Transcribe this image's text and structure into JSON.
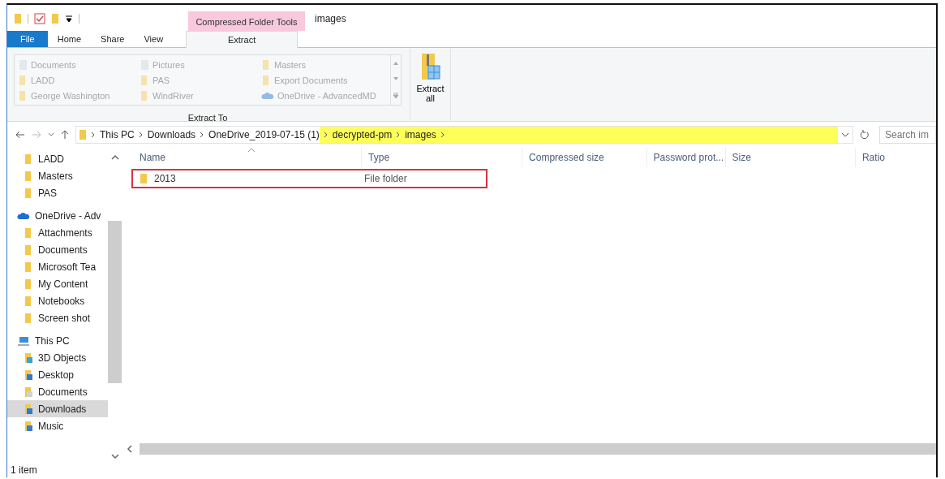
{
  "title_bar": {
    "context_tab_group": "Compressed Folder Tools",
    "title": "images"
  },
  "ribbon_tabs": [
    {
      "label": "File",
      "kind": "file",
      "selected": false
    },
    {
      "label": "Home",
      "kind": "tab",
      "selected": false
    },
    {
      "label": "Share",
      "kind": "tab",
      "selected": false
    },
    {
      "label": "View",
      "kind": "tab",
      "selected": false
    },
    {
      "label": "Extract",
      "kind": "context",
      "selected": true
    }
  ],
  "extract_to": {
    "group_label": "Extract To",
    "locations": [
      {
        "label": "Documents",
        "kind": "library",
        "disabled": true
      },
      {
        "label": "Pictures",
        "kind": "library",
        "disabled": true
      },
      {
        "label": "Masters",
        "kind": "folder",
        "disabled": true
      },
      {
        "label": "LADD",
        "kind": "folder",
        "disabled": true
      },
      {
        "label": "PAS",
        "kind": "folder",
        "disabled": true
      },
      {
        "label": "Export Documents",
        "kind": "folder",
        "disabled": true
      },
      {
        "label": "George Washington",
        "kind": "folder",
        "disabled": true
      },
      {
        "label": "WindRiver",
        "kind": "folder",
        "disabled": true
      },
      {
        "label": "OneDrive - AdvancedMD",
        "kind": "cloud",
        "disabled": true
      }
    ]
  },
  "extract_all_button": {
    "label": "Extract all"
  },
  "address_bar": {
    "breadcrumbs": [
      {
        "label": "This PC",
        "highlighted": false
      },
      {
        "label": "Downloads",
        "highlighted": false
      },
      {
        "label": "OneDrive_2019-07-15 (1)",
        "highlighted": false
      },
      {
        "label": "decrypted-pm",
        "highlighted": true
      },
      {
        "label": "images",
        "highlighted": true
      }
    ]
  },
  "search": {
    "placeholder": "Search im"
  },
  "sidebar": {
    "tree": [
      {
        "label": "LADD",
        "kind": "folder",
        "selected": false
      },
      {
        "label": "Masters",
        "kind": "folder",
        "selected": false
      },
      {
        "label": "PAS",
        "kind": "folder",
        "selected": false
      },
      {
        "label": "OneDrive - Adv",
        "kind": "cloud",
        "selected": false,
        "children": [
          {
            "label": "Attachments",
            "kind": "folder",
            "selected": false
          },
          {
            "label": "Documents",
            "kind": "folder",
            "selected": false
          },
          {
            "label": "Microsoft Tea",
            "kind": "folder",
            "selected": false
          },
          {
            "label": "My Content",
            "kind": "folder",
            "selected": false
          },
          {
            "label": "Notebooks",
            "kind": "folder",
            "selected": false
          },
          {
            "label": "Screen shot",
            "kind": "folder",
            "selected": false
          }
        ]
      },
      {
        "label": "This PC",
        "kind": "pc",
        "selected": false,
        "children": [
          {
            "label": "3D Objects",
            "kind": "objects",
            "selected": false
          },
          {
            "label": "Desktop",
            "kind": "desktop",
            "selected": false
          },
          {
            "label": "Documents",
            "kind": "documents",
            "selected": false
          },
          {
            "label": "Downloads",
            "kind": "downloads",
            "selected": true
          },
          {
            "label": "Music",
            "kind": "music",
            "selected": false
          }
        ]
      }
    ]
  },
  "table": {
    "columns": [
      {
        "label": "Name",
        "sorted": true
      },
      {
        "label": "Type",
        "sorted": false
      },
      {
        "label": "Compressed size",
        "sorted": false
      },
      {
        "label": "Password prot...",
        "sorted": false
      },
      {
        "label": "Size",
        "sorted": false
      },
      {
        "label": "Ratio",
        "sorted": false
      }
    ],
    "rows": [
      {
        "name": "2013",
        "type": "File folder",
        "outlined": true
      }
    ]
  },
  "status_bar": {
    "text": "1 item"
  }
}
